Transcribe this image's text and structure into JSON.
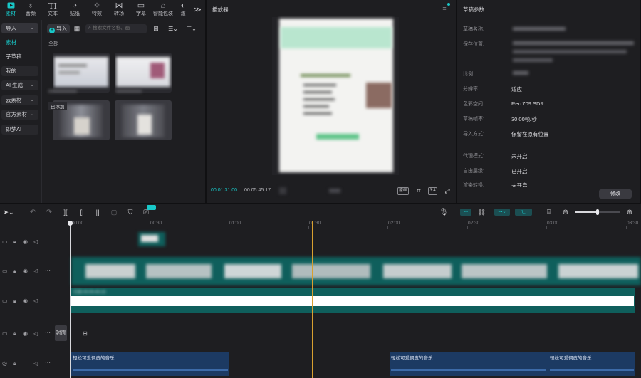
{
  "toolbar": {
    "items": [
      {
        "label": "素材",
        "icon": "media-icon"
      },
      {
        "label": "音频",
        "icon": "audio-icon"
      },
      {
        "label": "文本",
        "icon": "text-icon"
      },
      {
        "label": "贴纸",
        "icon": "sticker-icon"
      },
      {
        "label": "特效",
        "icon": "effects-icon"
      },
      {
        "label": "转场",
        "icon": "transition-icon"
      },
      {
        "label": "字幕",
        "icon": "subtitle-icon"
      },
      {
        "label": "智能包装",
        "icon": "smart-pack-icon"
      },
      {
        "label": "滤",
        "icon": "filter-icon"
      }
    ],
    "more": "≫"
  },
  "sidebar": {
    "items": [
      {
        "label": "导入",
        "chevron": true
      },
      {
        "label": "素材",
        "chevron": false
      },
      {
        "label": "子草稿",
        "chevron": false
      },
      {
        "label": "我的",
        "chevron": false
      },
      {
        "label": "AI 生成",
        "chevron": true
      },
      {
        "label": "云素材",
        "chevron": true
      },
      {
        "label": "官方素材",
        "chevron": true
      },
      {
        "label": "即梦AI",
        "chevron": false
      }
    ]
  },
  "media": {
    "import_label": "导入",
    "search_placeholder": "搜索文件名称、画",
    "all_label": "全部",
    "added_badge": "已添加"
  },
  "player": {
    "title": "播放器",
    "current_time": "00:01:31:00",
    "total_time": "00:05:45:17",
    "ratio_label": "原画",
    "aspect_label": "3:4"
  },
  "props": {
    "title": "草稿参数",
    "rows": [
      {
        "label": "草稿名称:",
        "value": ""
      },
      {
        "label": "保存位置:",
        "value": ""
      },
      {
        "label": "比例:",
        "value": ""
      },
      {
        "label": "分辨率:",
        "value": "适应"
      },
      {
        "label": "色彩空间:",
        "value": "Rec.709 SDR"
      },
      {
        "label": "草稿帧率:",
        "value": "30.00帧/秒"
      },
      {
        "label": "导入方式:",
        "value": "保留在原有位置"
      },
      {
        "label": "代理模式:",
        "value": "未开启"
      },
      {
        "label": "自由层级:",
        "value": "已开启"
      },
      {
        "label": "渲染转换:",
        "value": "未开启"
      }
    ],
    "modify_button": "修改"
  },
  "timeline": {
    "ruler": [
      "00:00",
      "00:30",
      "01:00",
      "01:30",
      "02:00",
      "02:30",
      "03:00",
      "03:30"
    ],
    "main_clip_label": "已选",
    "main_clip_time": "00:05:45:15",
    "cover_label": "封面",
    "audio_clips": [
      "轻松可爱调皮的音乐",
      "轻松可爱调皮的音乐",
      "轻松可爱调皮的音乐"
    ],
    "zoom_level": 0.5
  },
  "colors": {
    "accent": "#18c8c8",
    "panel": "#1e1e21",
    "track_teal": "#0f5f5c",
    "audio_blue": "#1c3a63",
    "playhead": "#d8a030"
  }
}
